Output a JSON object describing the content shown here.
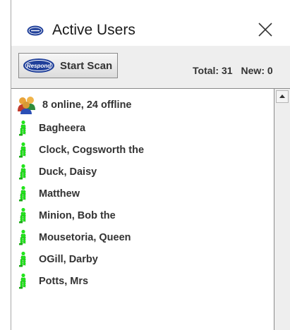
{
  "window": {
    "title": "Active Users",
    "icon": "respond-logo-icon",
    "close_icon": "close-icon"
  },
  "toolbar": {
    "scan_label": "Start Scan",
    "scan_icon": "respond-logo-icon",
    "total_label": "Total: 31",
    "new_label": "New: 0"
  },
  "list": {
    "summary": "8 online, 24 offline",
    "summary_icon": "user-group-icon",
    "item_icon": "online-user-icon",
    "item_icon_color": "#22e51c",
    "users": [
      "Bagheera",
      "Clock, Cogsworth the",
      "Duck, Daisy",
      "Matthew",
      "Minion, Bob the",
      "Mousetoria, Queen",
      "OGill, Darby",
      "Potts, Mrs"
    ]
  },
  "colors": {
    "text": "#333333",
    "logo_blue": "#1f3f9a",
    "border": "#8a8a8a",
    "chrome": "#eeeeee"
  }
}
